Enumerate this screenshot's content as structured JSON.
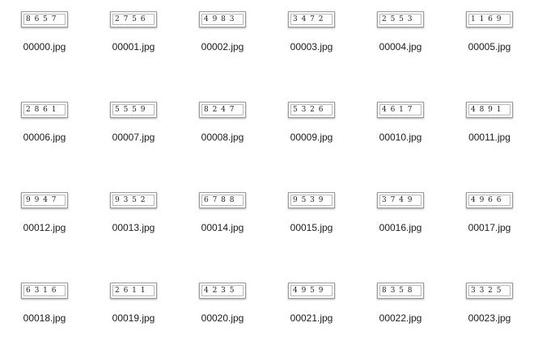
{
  "files": [
    {
      "name": "00000.jpg",
      "captcha": "8 6 5 7"
    },
    {
      "name": "00001.jpg",
      "captcha": "2 7 5 6"
    },
    {
      "name": "00002.jpg",
      "captcha": "4 9 8 3"
    },
    {
      "name": "00003.jpg",
      "captcha": "3 4 7 2"
    },
    {
      "name": "00004.jpg",
      "captcha": "2 5 5 3"
    },
    {
      "name": "00005.jpg",
      "captcha": "1 1 6 9"
    },
    {
      "name": "00006.jpg",
      "captcha": "2 8 6 1"
    },
    {
      "name": "00007.jpg",
      "captcha": "5 5 5 9"
    },
    {
      "name": "00008.jpg",
      "captcha": "8 2 4 7"
    },
    {
      "name": "00009.jpg",
      "captcha": "5 3 2 6"
    },
    {
      "name": "00010.jpg",
      "captcha": "4 6 1 7"
    },
    {
      "name": "00011.jpg",
      "captcha": "4 8 9 1"
    },
    {
      "name": "00012.jpg",
      "captcha": "9 9 4 7"
    },
    {
      "name": "00013.jpg",
      "captcha": "9 3 5 2"
    },
    {
      "name": "00014.jpg",
      "captcha": "6 7 8 8"
    },
    {
      "name": "00015.jpg",
      "captcha": "9 5 3 9"
    },
    {
      "name": "00016.jpg",
      "captcha": "3 7 4 9"
    },
    {
      "name": "00017.jpg",
      "captcha": "4 9 6 6"
    },
    {
      "name": "00018.jpg",
      "captcha": "6 3 1 6"
    },
    {
      "name": "00019.jpg",
      "captcha": "2 6 1 1"
    },
    {
      "name": "00020.jpg",
      "captcha": "4 2 3 5"
    },
    {
      "name": "00021.jpg",
      "captcha": "4 9 5 9"
    },
    {
      "name": "00022.jpg",
      "captcha": "8 3 5 8"
    },
    {
      "name": "00023.jpg",
      "captcha": "3 3 2 5"
    }
  ]
}
